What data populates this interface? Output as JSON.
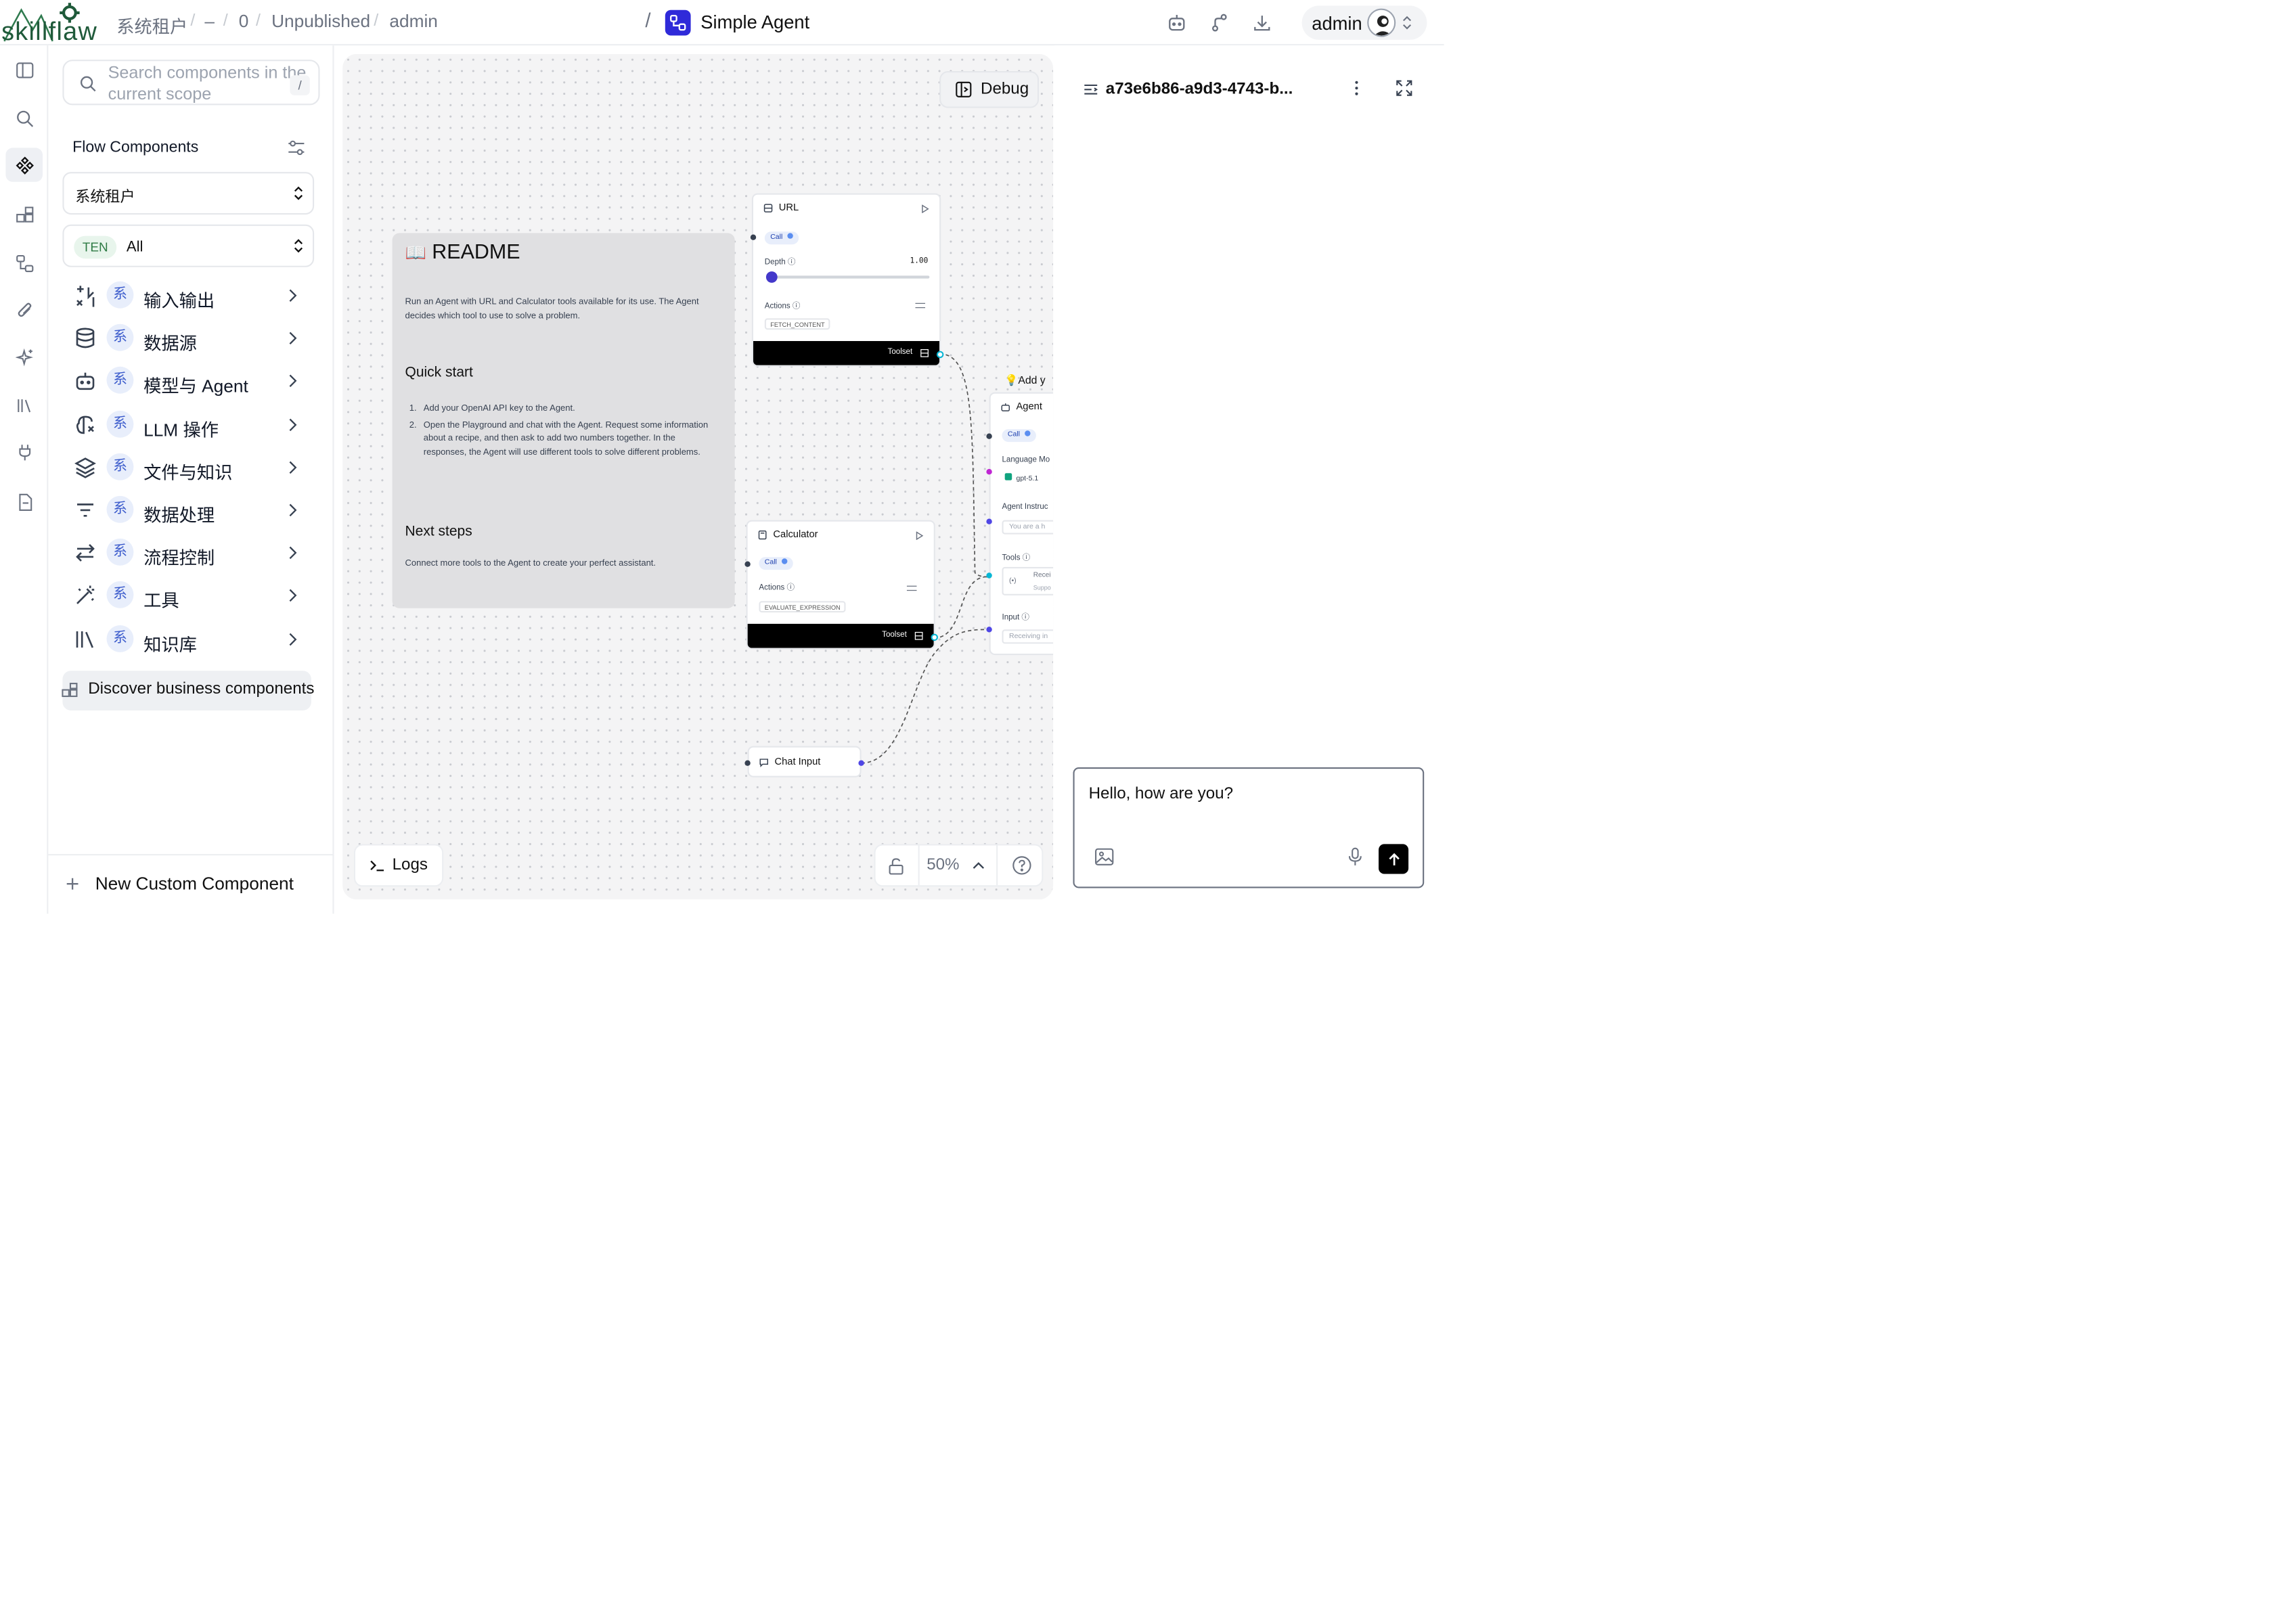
{
  "header": {
    "brand": "skillflaw",
    "tenant": "系统租户",
    "dash": "–",
    "count": "0",
    "status": "Unpublished",
    "owner": "admin",
    "flow_name": "Simple Agent",
    "user": "admin"
  },
  "sidebar": {
    "search_placeholder": "Search components in the current scope",
    "search_shortcut": "/",
    "section_title": "Flow Components",
    "tenant_select": "系统租户",
    "filter_tag": "TEN",
    "filter_value": "All",
    "badge": "系",
    "categories": [
      {
        "label": "输入输出",
        "icon": "io-icon"
      },
      {
        "label": "数据源",
        "icon": "database-icon"
      },
      {
        "label": "模型与 Agent",
        "icon": "bot-icon"
      },
      {
        "label": "LLM 操作",
        "icon": "brain-icon"
      },
      {
        "label": "文件与知识",
        "icon": "layers-icon"
      },
      {
        "label": "数据处理",
        "icon": "filter-icon"
      },
      {
        "label": "流程控制",
        "icon": "arrows-icon"
      },
      {
        "label": "工具",
        "icon": "wand-icon"
      },
      {
        "label": "知识库",
        "icon": "library-icon"
      }
    ],
    "discover": "Discover business components",
    "new_custom": "New Custom Component"
  },
  "canvas": {
    "debug_label": "Debug",
    "logs_label": "Logs",
    "zoom": "50%",
    "readme": {
      "title": "README",
      "intro": "Run an Agent with URL and Calculator tools available for its use. The Agent decides which tool to use to solve a problem.",
      "quick_start": "Quick start",
      "steps": [
        "Add your OpenAI API key to the Agent.",
        "Open the Playground and chat with the Agent. Request some information about a recipe, and then ask to add two numbers together. In the responses, the Agent will use different tools to solve different problems."
      ],
      "next_steps": "Next steps",
      "next_text": "Connect more tools to the Agent to create your perfect assistant."
    },
    "url_node": {
      "title": "URL",
      "mode": "Call",
      "depth_label": "Depth",
      "depth_value": "1.00",
      "depth_fraction": 0.0,
      "actions_label": "Actions",
      "action": "FETCH_CONTENT",
      "footer": "Toolset"
    },
    "calc_node": {
      "title": "Calculator",
      "mode": "Call",
      "actions_label": "Actions",
      "action": "EVALUATE_EXPRESSION",
      "footer": "Toolset"
    },
    "chat_input_node": {
      "title": "Chat Input"
    },
    "agent_note": "Add y",
    "agent_node": {
      "title": "Agent",
      "mode": "Call",
      "lang_label": "Language Mo",
      "model": "gpt-5.1",
      "instr_label": "Agent Instruc",
      "instr_placeholder": "You are a h",
      "tools_label": "Tools",
      "tools_line1": "Recei",
      "tools_line2": "Suppo",
      "input_label": "Input",
      "input_placeholder": "Receiving in"
    }
  },
  "panel": {
    "session_id": "a73e6b86-a9d3-4743-b...",
    "message": "Hello, how are you?"
  },
  "colors": {
    "accent": "#2f2ad9",
    "badge_bg": "#e8eefb",
    "badge_fg": "#3b5bcc",
    "canvas_bg": "#f4f4f5"
  }
}
